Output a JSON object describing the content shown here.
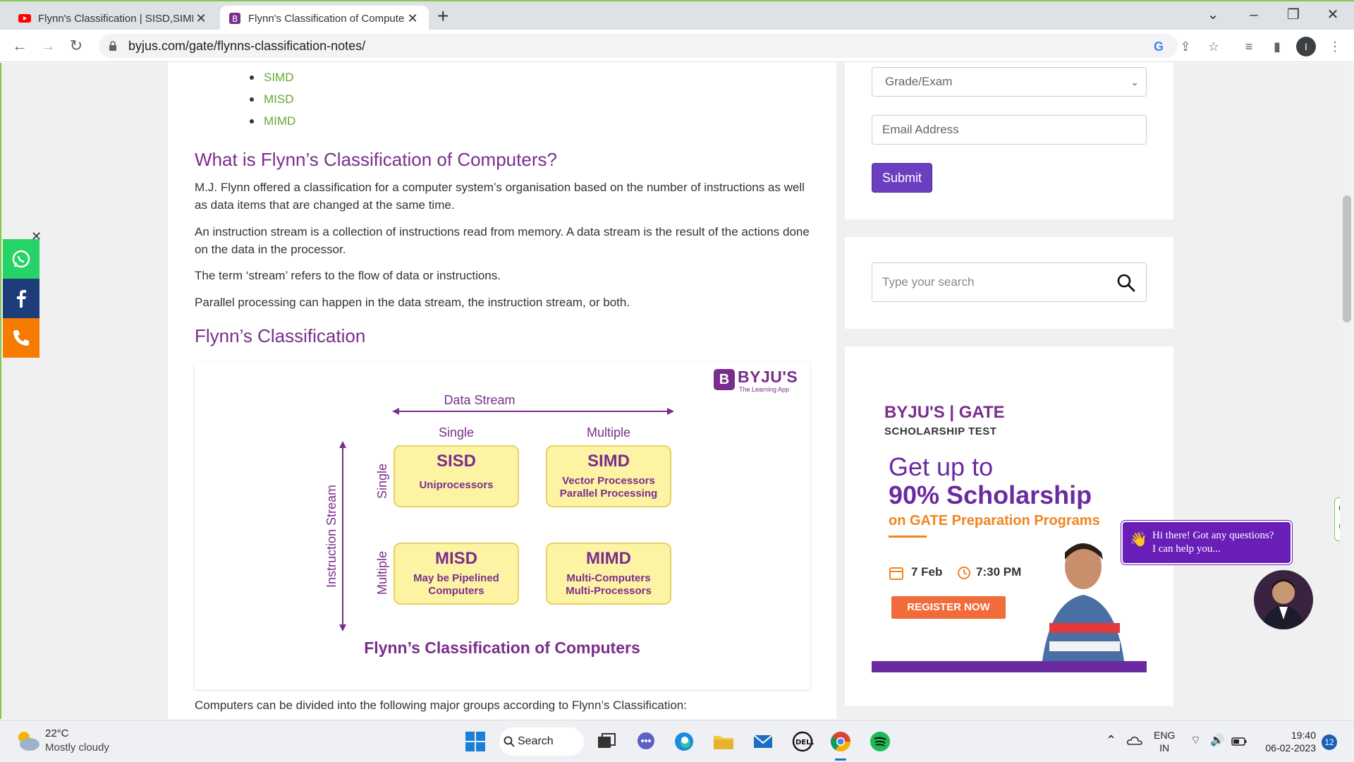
{
  "browser": {
    "tabs": [
      {
        "title": "Flynn's Classification | SISD,SIMD",
        "close": "✕"
      },
      {
        "title": "Flynn's Classification of Compute",
        "close": "✕"
      }
    ],
    "new_tab": "+",
    "url": "byjus.com/gate/flynns-classification-notes/",
    "profile_initial": "I"
  },
  "article": {
    "bullets": [
      "SIMD",
      "MISD",
      "MIMD"
    ],
    "heading1": "What is Flynn’s Classification of Computers?",
    "para1": "M.J. Flynn offered a classification for a computer system’s organisation based on the number of instructions as well as data items that are changed at the same time.",
    "para2": "An instruction stream is a collection of instructions read from memory. A data stream is the result of the actions done on the data in the processor.",
    "para3": "The term ‘stream’ refers to the flow of data or instructions.",
    "para4": "Parallel processing can happen in the data stream, the instruction stream, or both.",
    "heading2": "Flynn’s Classification",
    "para5": "Computers can be divided into the following major groups according to Flynn’s Classification:"
  },
  "figure": {
    "logo_mark": "B",
    "logo_text": "BYJU'S",
    "logo_sub": "The Learning App",
    "data_stream": "Data Stream",
    "instruction_stream": "Instruction Stream",
    "col_single": "Single",
    "col_multiple": "Multiple",
    "row_single": "Single",
    "row_multiple": "Multiple",
    "cells": [
      {
        "title": "SISD",
        "line1": "Uniprocessors",
        "line2": ""
      },
      {
        "title": "SIMD",
        "line1": "Vector Processors",
        "line2": "Parallel Processing"
      },
      {
        "title": "MISD",
        "line1": "May be Pipelined",
        "line2": "Computers"
      },
      {
        "title": "MIMD",
        "line1": "Multi-Computers",
        "line2": "Multi-Processors"
      }
    ],
    "caption": "Flynn’s Classification of Computers"
  },
  "sidebar": {
    "grade_select": "Grade/Exam",
    "email_placeholder": "Email Address",
    "submit": "Submit",
    "search_placeholder": "Type your search"
  },
  "ad": {
    "brand": "BYJU'S | GATE",
    "sub": "SCHOLARSHIP TEST",
    "line1": "Get up to",
    "line2": "90% Scholarship",
    "line3": "on GATE Preparation Programs",
    "date": "7 Feb",
    "time": "7:30 PM",
    "cta": "REGISTER NOW"
  },
  "chat": {
    "line1": "Hi there! Got any questions?",
    "line2": "I can help you..."
  },
  "taskbar": {
    "temp": "22°C",
    "weather": "Mostly cloudy",
    "search": "Search",
    "lang1": "ENG",
    "lang2": "IN",
    "time": "19:40",
    "date": "06-02-2023",
    "notifications": "12"
  },
  "colors": {
    "accent_purple": "#7a2e8c",
    "link_green": "#66a832",
    "submit_purple": "#6c3ec0"
  }
}
